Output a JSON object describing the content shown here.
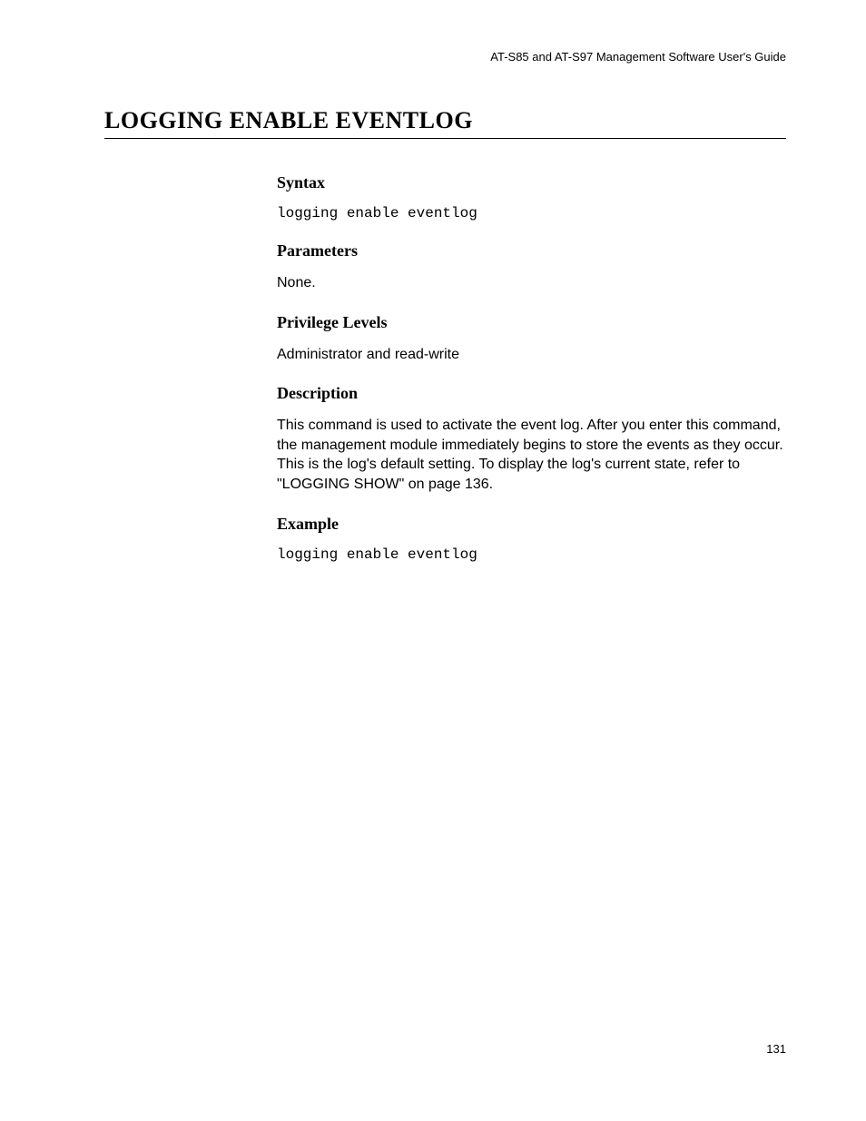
{
  "header": "AT-S85 and AT-S97 Management Software User's Guide",
  "title": "LOGGING ENABLE EVENTLOG",
  "sections": {
    "syntax": {
      "heading": "Syntax",
      "content": "logging enable eventlog"
    },
    "parameters": {
      "heading": "Parameters",
      "content": "None."
    },
    "privilege": {
      "heading": "Privilege Levels",
      "content": "Administrator and read-write"
    },
    "description": {
      "heading": "Description",
      "content": "This command is used to activate the event log. After you enter this command, the management module immediately begins to store the events as they occur. This is the log's default setting. To display the log's current state, refer to \"LOGGING SHOW\" on page 136."
    },
    "example": {
      "heading": "Example",
      "content": "logging enable eventlog"
    }
  },
  "pageNumber": "131"
}
